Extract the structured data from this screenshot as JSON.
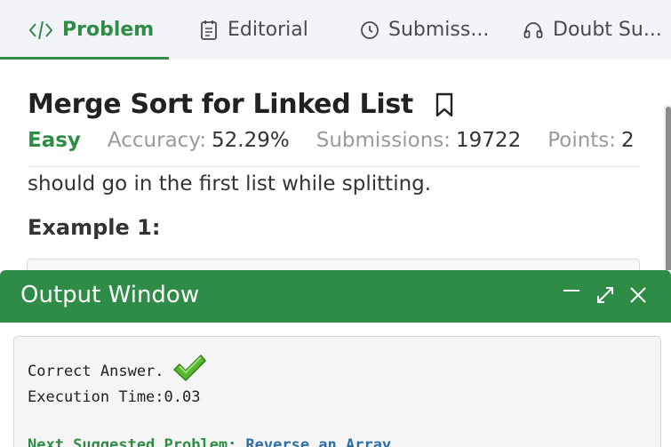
{
  "tabs": [
    {
      "label": "Problem",
      "icon": "code-icon",
      "active": true
    },
    {
      "label": "Editorial",
      "icon": "document-icon",
      "active": false
    },
    {
      "label": "Submiss...",
      "icon": "clock-icon",
      "active": false
    },
    {
      "label": "Doubt Su...",
      "icon": "headphones-icon",
      "active": false
    }
  ],
  "problem": {
    "title": "Merge Sort for Linked List",
    "difficulty": "Easy",
    "accuracy_label": "Accuracy:",
    "accuracy_value": "52.29%",
    "submissions_label": "Submissions:",
    "submissions_value": "19722",
    "points_label": "Points:",
    "points_value": "2",
    "description_visible": "should go in the first list while splitting.",
    "example_heading": "Example 1:"
  },
  "output": {
    "title": "Output Window",
    "result": "Correct Answer.",
    "execution_time": "Execution Time:0.03",
    "next_label": "Next Suggested Problem:",
    "next_link": "Reverse an Array"
  },
  "colors": {
    "accent_green": "#2f8c46",
    "link_blue": "#2f6fa8",
    "tab_bar_bg": "#f3f4f9"
  }
}
